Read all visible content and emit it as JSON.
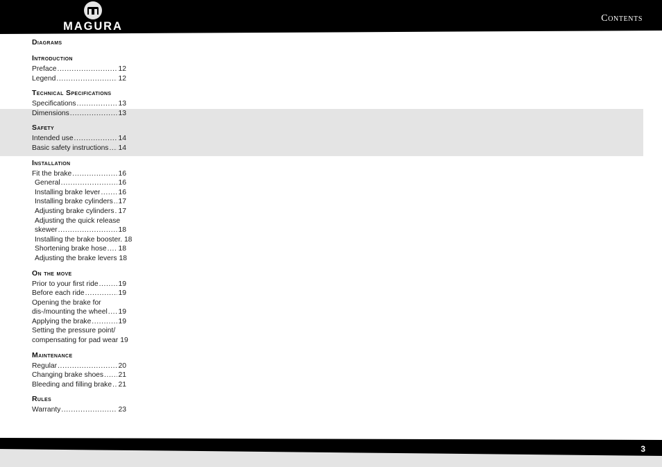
{
  "header": {
    "brand_wordmark": "MAGURA",
    "brand_mark_icon": "magura-logo-icon",
    "title": "Contents"
  },
  "colors": {
    "header_bg": "#000000",
    "footer_bg": "#000000",
    "highlight_band": "#e4e4e4",
    "page_bg": "#ffffff",
    "text": "#1a1a1a"
  },
  "toc": {
    "groups": [
      {
        "heading": "Diagrams",
        "entries": []
      },
      {
        "heading": "Introduction",
        "entries": [
          {
            "label": "Preface",
            "page": "12",
            "level": 1
          },
          {
            "label": "Legend",
            "page": "12",
            "level": 1
          }
        ]
      },
      {
        "heading": "Technical Specifications",
        "entries": [
          {
            "label": "Specifications",
            "page": "13",
            "level": 1
          },
          {
            "label": "Dimensions",
            "page": "13",
            "level": 1
          }
        ]
      },
      {
        "heading": "Safety",
        "highlighted": true,
        "entries": [
          {
            "label": "Intended use",
            "page": "14",
            "level": 1
          },
          {
            "label": "Basic safety instructions",
            "page": "14",
            "level": 1
          }
        ]
      },
      {
        "heading": "Installation",
        "entries": [
          {
            "label": "Fit the brake",
            "page": "16",
            "level": 1
          },
          {
            "label": "General",
            "page": "16",
            "level": 2
          },
          {
            "label": "Installing brake lever",
            "page": "16",
            "level": 2
          },
          {
            "label": "Installing brake cylinders",
            "page": "17",
            "level": 2
          },
          {
            "label": "Adjusting brake cylinders",
            "page": "17",
            "level": 2
          },
          {
            "label": "Adjusting the quick release",
            "page": "",
            "level": 2,
            "wrapped": true
          },
          {
            "label": "skewer",
            "page": "18",
            "level": 2
          },
          {
            "label": "Installing the brake booster.",
            "page": "18",
            "level": 2
          },
          {
            "label": "Shortening brake hose",
            "page": "18",
            "level": 2
          },
          {
            "label": "Adjusting the brake levers",
            "page": "18",
            "level": 2
          }
        ]
      },
      {
        "heading": "On the move",
        "entries": [
          {
            "label": "Prior to your first ride",
            "page": "19",
            "level": 1
          },
          {
            "label": "Before each ride",
            "page": "19",
            "level": 1
          },
          {
            "label": "Opening the brake for",
            "page": "",
            "level": 1,
            "wrapped": true
          },
          {
            "label": "dis-/mounting the wheel",
            "page": "19",
            "level": 1
          },
          {
            "label": "Applying the brake",
            "page": "19",
            "level": 1
          },
          {
            "label": "Setting the pressure point/",
            "page": "",
            "level": 1,
            "wrapped": true
          },
          {
            "label": "compensating for pad wear",
            "page": "19",
            "level": 1,
            "nodots": true
          }
        ]
      },
      {
        "heading": "Maintenance",
        "entries": [
          {
            "label": "Regular",
            "page": "20",
            "level": 1
          },
          {
            "label": "Changing brake shoes",
            "page": "21",
            "level": 1
          },
          {
            "label": "Bleeding and filling brake",
            "page": "21",
            "level": 1
          }
        ]
      },
      {
        "heading": "Rules",
        "entries": [
          {
            "label": "Warranty",
            "page": "23",
            "level": 1
          }
        ]
      }
    ]
  },
  "footer": {
    "page_number": "3"
  }
}
